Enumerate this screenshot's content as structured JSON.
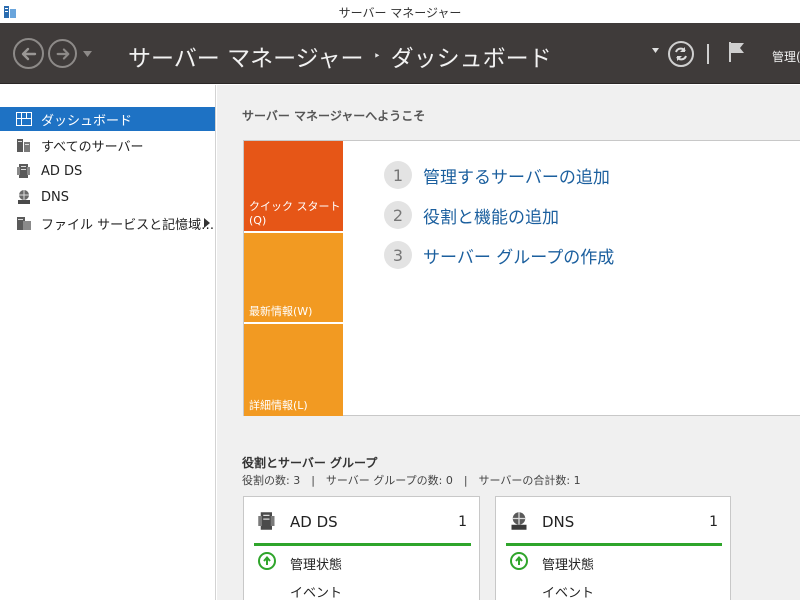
{
  "window": {
    "title": "サーバー マネージャー"
  },
  "header": {
    "breadcrumb_root": "サーバー マネージャー",
    "breadcrumb_separator": "‣",
    "breadcrumb_current": "ダッシュボード",
    "manage_label": "管理("
  },
  "sidebar": {
    "items": [
      {
        "label": "ダッシュボード",
        "icon": "dashboard-icon",
        "active": true
      },
      {
        "label": "すべてのサーバー",
        "icon": "servers-icon"
      },
      {
        "label": "AD DS",
        "icon": "adds-icon"
      },
      {
        "label": "DNS",
        "icon": "dns-icon"
      },
      {
        "label": "ファイル サービスと記憶域…",
        "icon": "file-services-icon",
        "has_submenu": true
      }
    ]
  },
  "main": {
    "welcome_title": "サーバー マネージャーへようこそ",
    "tiles": [
      {
        "label": "クイック スタート",
        "shortcut": "(Q)"
      },
      {
        "label": "最新情報(W)"
      },
      {
        "label": "詳細情報(L)"
      }
    ],
    "steps": [
      {
        "num": "1",
        "label": "管理するサーバーの追加"
      },
      {
        "num": "2",
        "label": "役割と機能の追加"
      },
      {
        "num": "3",
        "label": "サーバー グループの作成"
      }
    ],
    "roles_title": "役割とサーバー グループ",
    "roles_summary": "役割の数: 3　|　サーバー グループの数: 0　|　サーバーの合計数: 1",
    "cards": [
      {
        "name": "AD DS",
        "count": "1",
        "icon": "adds-icon",
        "state_label": "管理状態",
        "event_label": "イベント"
      },
      {
        "name": "DNS",
        "count": "1",
        "icon": "dns-icon",
        "state_label": "管理状態",
        "event_label": "イベント"
      }
    ]
  },
  "colors": {
    "header_bg": "#3f3b3a",
    "sidebar_active": "#1e72c4",
    "tile_quickstart": "#e65617",
    "tile_other": "#f29a22",
    "link_blue": "#1b5f9e",
    "status_green": "#2fa52b"
  }
}
